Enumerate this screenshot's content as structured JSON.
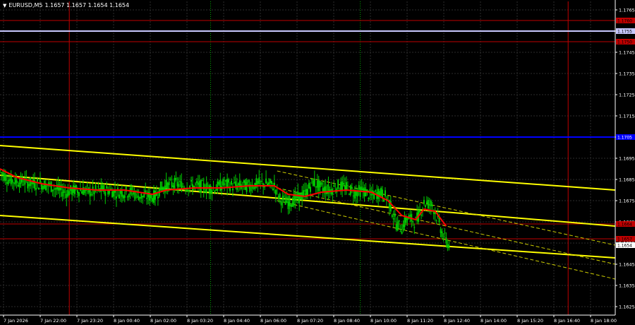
{
  "header": {
    "symbol": "EURUSD,M5",
    "ohlc": "1.1657 1.1657 1.1654 1.1654",
    "dropdown_icon": "triangle-down-icon"
  },
  "colors": {
    "background": "#000000",
    "grid": "#2b2b2b",
    "candle": "#00cc00",
    "ma": "#ff0000",
    "channel": "#ffff00",
    "channel_dashed": "#cccc00",
    "level_red": "#c00000",
    "level_blue": "#0000ff",
    "level_white": "#c8c8ff",
    "vline_red": "#c00000",
    "vline_green": "#00aa00",
    "axis": "#ffffff",
    "price_tag_text": "#000000"
  },
  "chart_data": {
    "type": "line",
    "ylim": [
      1.1621,
      1.1769
    ],
    "grid": true,
    "y_ticks": [
      "1.1765",
      "1.1755",
      "1.1745",
      "1.1735",
      "1.1725",
      "1.1715",
      "1.1705",
      "1.1695",
      "1.1685",
      "1.1675",
      "1.1665",
      "1.1655",
      "1.1645",
      "1.1635",
      "1.1625"
    ],
    "x_ticks": [
      "7 Jan 2026",
      "7 Jan 22:00",
      "7 Jan 23:20",
      "8 Jan 00:40",
      "8 Jan 02:00",
      "8 Jan 03:20",
      "8 Jan 04:40",
      "8 Jan 06:00",
      "8 Jan 07:20",
      "8 Jan 08:40",
      "8 Jan 10:00",
      "8 Jan 11:20",
      "8 Jan 12:40",
      "8 Jan 14:00",
      "8 Jan 15:20",
      "8 Jan 16:40",
      "8 Jan 18:00"
    ],
    "x_range": [
      0,
      222
    ],
    "price_series": [
      [
        0,
        1.1689
      ],
      [
        3,
        1.1685
      ],
      [
        6,
        1.1684
      ],
      [
        9,
        1.1684
      ],
      [
        12,
        1.1683
      ],
      [
        15,
        1.1683
      ],
      [
        18,
        1.1682
      ],
      [
        21,
        1.168
      ],
      [
        24,
        1.1679
      ],
      [
        27,
        1.168
      ],
      [
        30,
        1.168
      ],
      [
        33,
        1.1679
      ],
      [
        36,
        1.168
      ],
      [
        39,
        1.168
      ],
      [
        42,
        1.1679
      ],
      [
        45,
        1.1679
      ],
      [
        48,
        1.1679
      ],
      [
        51,
        1.1677
      ],
      [
        54,
        1.1677
      ],
      [
        56,
        1.1677
      ],
      [
        58,
        1.1681
      ],
      [
        60,
        1.1682
      ],
      [
        63,
        1.1683
      ],
      [
        66,
        1.1682
      ],
      [
        69,
        1.1682
      ],
      [
        72,
        1.1682
      ],
      [
        75,
        1.1681
      ],
      [
        78,
        1.1681
      ],
      [
        81,
        1.1683
      ],
      [
        84,
        1.1682
      ],
      [
        87,
        1.1682
      ],
      [
        90,
        1.1682
      ],
      [
        93,
        1.1683
      ],
      [
        96,
        1.1683
      ],
      [
        99,
        1.1682
      ],
      [
        101,
        1.1676
      ],
      [
        104,
        1.1674
      ],
      [
        107,
        1.1676
      ],
      [
        110,
        1.1678
      ],
      [
        113,
        1.1684
      ],
      [
        116,
        1.1681
      ],
      [
        119,
        1.168
      ],
      [
        122,
        1.1682
      ],
      [
        125,
        1.1681
      ],
      [
        128,
        1.1679
      ],
      [
        131,
        1.168
      ],
      [
        134,
        1.1677
      ],
      [
        137,
        1.1679
      ],
      [
        140,
        1.1676
      ],
      [
        143,
        1.1664
      ],
      [
        145,
        1.1662
      ],
      [
        147,
        1.1667
      ],
      [
        150,
        1.1665
      ],
      [
        153,
        1.1674
      ],
      [
        156,
        1.1673
      ],
      [
        158,
        1.1666
      ],
      [
        160,
        1.1658
      ],
      [
        162,
        1.1654
      ]
    ],
    "ma_series": [
      [
        0,
        1.169
      ],
      [
        6,
        1.1686
      ],
      [
        15,
        1.1683
      ],
      [
        25,
        1.1681
      ],
      [
        35,
        1.168
      ],
      [
        45,
        1.168
      ],
      [
        55,
        1.1678
      ],
      [
        60,
        1.168
      ],
      [
        70,
        1.1681
      ],
      [
        80,
        1.1681
      ],
      [
        90,
        1.1682
      ],
      [
        99,
        1.1682
      ],
      [
        104,
        1.1678
      ],
      [
        110,
        1.1677
      ],
      [
        116,
        1.1679
      ],
      [
        125,
        1.168
      ],
      [
        134,
        1.1679
      ],
      [
        140,
        1.1675
      ],
      [
        145,
        1.1668
      ],
      [
        150,
        1.1666
      ],
      [
        153,
        1.1671
      ],
      [
        157,
        1.167
      ],
      [
        161,
        1.1663
      ]
    ],
    "channels": [
      {
        "style": "solid",
        "points": [
          [
            0,
            1.1701
          ],
          [
            222,
            1.168
          ]
        ]
      },
      {
        "style": "solid",
        "points": [
          [
            0,
            1.1687
          ],
          [
            222,
            1.1663
          ]
        ]
      },
      {
        "style": "solid",
        "points": [
          [
            0,
            1.1668
          ],
          [
            222,
            1.1648
          ]
        ]
      },
      {
        "style": "dashed",
        "points": [
          [
            100,
            1.1689
          ],
          [
            222,
            1.1654
          ]
        ]
      },
      {
        "style": "dashed",
        "points": [
          [
            100,
            1.1681
          ],
          [
            222,
            1.1645
          ]
        ]
      },
      {
        "style": "dashed",
        "points": [
          [
            100,
            1.1675
          ],
          [
            222,
            1.1638
          ]
        ]
      }
    ],
    "horizontal_levels": [
      {
        "price": 1.176,
        "color": "red",
        "label": "1.1760"
      },
      {
        "price": 1.1755,
        "color": "white",
        "label": "1.1755"
      },
      {
        "price": 1.175,
        "color": "red",
        "label": "1.1750"
      },
      {
        "price": 1.1705,
        "color": "blue",
        "label": "1.1705"
      },
      {
        "price": 1.1664,
        "color": "red",
        "label": "1.1664"
      },
      {
        "price": 1.1657,
        "color": "red",
        "label": "1.1657"
      }
    ],
    "current_price": "1.1654",
    "vertical_lines": [
      {
        "x": 25,
        "color": "red",
        "style": "solid"
      },
      {
        "x": 205,
        "color": "red",
        "style": "solid"
      },
      {
        "x": 76,
        "color": "green",
        "style": "dotted"
      },
      {
        "x": 130,
        "color": "green",
        "style": "dotted"
      }
    ]
  }
}
